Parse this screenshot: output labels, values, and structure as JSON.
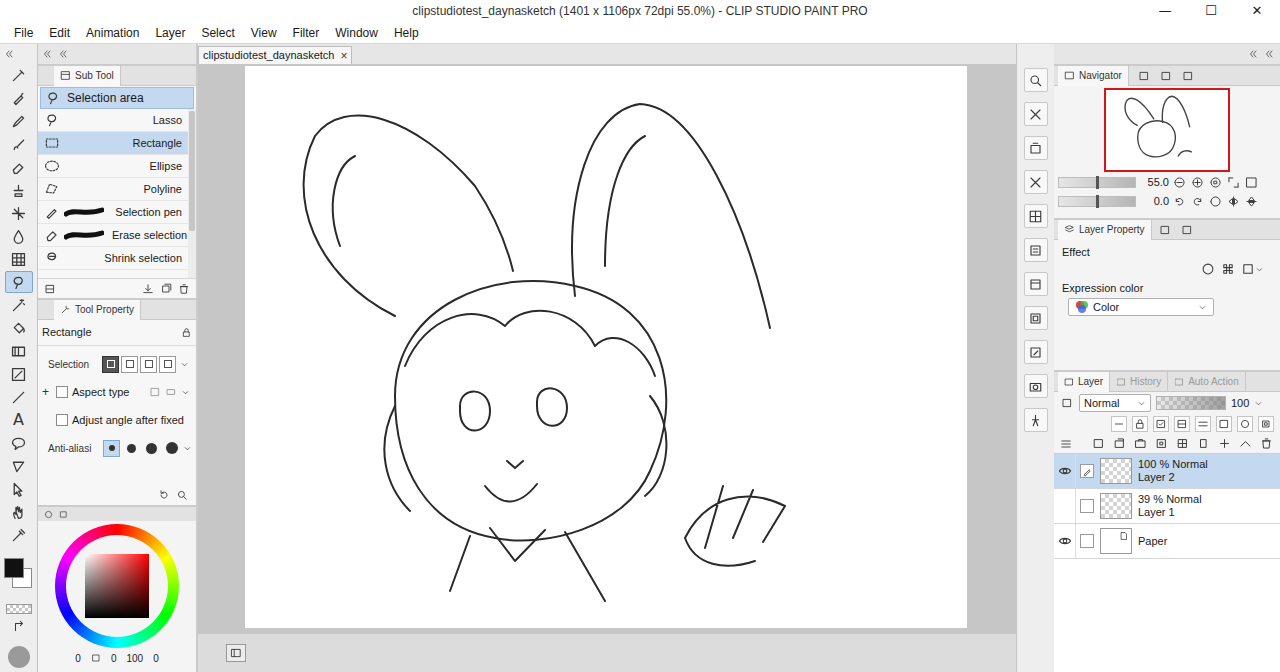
{
  "window": {
    "title": "clipstudiotest_daynasketch (1401 x 1106px 72dpi 55.0%) - CLIP STUDIO PAINT PRO",
    "controls": [
      "—",
      "☐",
      "✕"
    ]
  },
  "menu": [
    "File",
    "Edit",
    "Animation",
    "Layer",
    "Select",
    "View",
    "Filter",
    "Window",
    "Help"
  ],
  "toolbar": {
    "tools": [
      {
        "selected": false
      },
      {
        "selected": false
      },
      {
        "selected": false
      },
      {
        "selected": false
      },
      {
        "selected": false
      },
      {
        "selected": false
      },
      {
        "selected": false
      },
      {
        "selected": false
      },
      {
        "selected": false
      },
      {
        "selected": true
      },
      {
        "selected": false
      },
      {
        "selected": false
      },
      {
        "selected": false
      },
      {
        "selected": false
      },
      {
        "selected": false
      },
      {
        "selected": false,
        "glyph": "A"
      },
      {
        "selected": false
      },
      {
        "selected": false
      },
      {
        "selected": false
      },
      {
        "selected": false
      },
      {
        "selected": false
      }
    ]
  },
  "sub_tool": {
    "tab": "Sub Tool",
    "group": "Selection area",
    "items": [
      {
        "label": "Lasso",
        "kind": "shape",
        "selected": false
      },
      {
        "label": "Rectangle",
        "kind": "shape",
        "selected": true
      },
      {
        "label": "Ellipse",
        "kind": "shape",
        "selected": false
      },
      {
        "label": "Polyline",
        "kind": "shape",
        "selected": false
      },
      {
        "label": "Selection pen",
        "kind": "brush",
        "selected": false
      },
      {
        "label": "Erase selection",
        "kind": "brush",
        "selected": false
      },
      {
        "label": "Shrink selection",
        "kind": "shape",
        "selected": false
      }
    ]
  },
  "tool_property": {
    "tab": "Tool Property",
    "tool": "Rectangle",
    "rows": [
      {
        "kind": "modes",
        "label": "Selection",
        "options": [
          {
            "selected": true
          },
          {
            "selected": false
          },
          {
            "selected": false
          },
          {
            "selected": false
          }
        ]
      },
      {
        "kind": "checkbox",
        "label": "Aspect type",
        "checked": false,
        "expander": "+"
      },
      {
        "kind": "checkbox",
        "label": "Adjust angle after fixed",
        "checked": false
      },
      {
        "kind": "circles",
        "label": "Anti-aliasi",
        "options": [
          {
            "selected": true
          },
          {
            "selected": false
          },
          {
            "selected": false
          },
          {
            "selected": false
          }
        ]
      }
    ]
  },
  "color": {
    "main": "#111111",
    "sub": "#ffffff",
    "values": [
      "0",
      "0",
      "100",
      "0"
    ]
  },
  "document_tab": {
    "label": "clipstudiotest_daynasketch",
    "close": "×"
  },
  "navigator": {
    "tab": "Navigator",
    "zoom": {
      "reading": "55.0",
      "level": 0.5
    },
    "rotation": {
      "reading": "0.0",
      "level": 0.5
    }
  },
  "layer_property": {
    "tab": "Layer Property",
    "effect": "Effect",
    "expression_label": "Expression color",
    "expression_value": "Color"
  },
  "layer_panel": {
    "tabs": [
      {
        "label": "Layer",
        "selected": true
      },
      {
        "label": "History",
        "selected": false
      },
      {
        "label": "Auto Action",
        "selected": false
      }
    ],
    "blend_mode": "Normal",
    "opacity": {
      "reading": "100",
      "level": 1
    },
    "layers": [
      {
        "kind": "raster",
        "info": "100 % Normal",
        "name": "Layer 2",
        "visible": true,
        "editing": true,
        "selected": true
      },
      {
        "kind": "raster",
        "info": "39 % Normal",
        "name": "Layer 1",
        "visible": false,
        "editing": false,
        "selected": false
      },
      {
        "kind": "paper",
        "name": "Paper",
        "visible": true,
        "editing": false,
        "selected": false
      }
    ]
  }
}
